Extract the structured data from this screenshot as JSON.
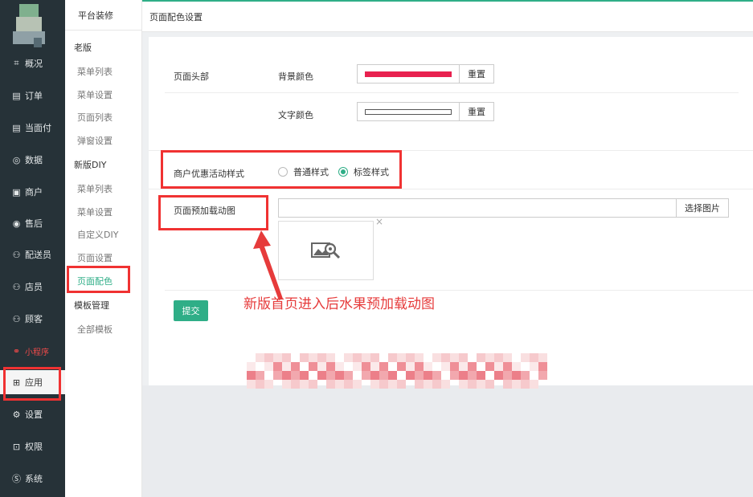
{
  "sidebar": {
    "items": [
      {
        "label": "概况",
        "icon": "overview-icon",
        "glyph": "⌗"
      },
      {
        "label": "订单",
        "icon": "order-icon",
        "glyph": "▤"
      },
      {
        "label": "当面付",
        "icon": "pay-icon",
        "glyph": "▤"
      },
      {
        "label": "数据",
        "icon": "data-icon",
        "glyph": "◎"
      },
      {
        "label": "商户",
        "icon": "merchant-icon",
        "glyph": "▣"
      },
      {
        "label": "售后",
        "icon": "aftersale-icon",
        "glyph": "◉"
      },
      {
        "label": "配送员",
        "icon": "courier-icon",
        "glyph": "⚇"
      },
      {
        "label": "店员",
        "icon": "clerk-icon",
        "glyph": "⚇"
      },
      {
        "label": "顾客",
        "icon": "customer-icon",
        "glyph": "⚇"
      },
      {
        "label": "小程序",
        "icon": "miniapp-icon",
        "glyph": "⚭"
      },
      {
        "label": "应用",
        "icon": "app-icon",
        "glyph": "⊞"
      },
      {
        "label": "设置",
        "icon": "settings-icon",
        "glyph": "⚙"
      },
      {
        "label": "权限",
        "icon": "lock-icon",
        "glyph": "⊡"
      },
      {
        "label": "系统",
        "icon": "system-icon",
        "glyph": "Ⓢ"
      }
    ]
  },
  "submenu": {
    "title": "平台装修",
    "groups": [
      {
        "label": "老版",
        "items": [
          "菜单列表",
          "菜单设置",
          "页面列表",
          "弹窗设置"
        ]
      },
      {
        "label": "新版DIY",
        "items": [
          "菜单列表",
          "菜单设置",
          "自定义DIY",
          "页面设置",
          "页面配色"
        ]
      },
      {
        "label": "模板管理",
        "items": [
          "全部模板"
        ]
      }
    ]
  },
  "page": {
    "title": "页面配色设置",
    "header_section_label": "页面头部",
    "bg_color_label": "背景颜色",
    "bg_color_value": "#e8214f",
    "text_color_label": "文字颜色",
    "text_color_value": "#ffffff",
    "reset_label": "重置",
    "promo_style_label": "商户优惠活动样式",
    "promo_options": [
      {
        "label": "普通样式",
        "checked": false
      },
      {
        "label": "标签样式",
        "checked": true
      }
    ],
    "preload_label": "页面预加载动图",
    "preload_value": "",
    "pick_image_label": "选择图片",
    "thumb_close": "×",
    "submit_label": "提交"
  },
  "annotation": {
    "note": "新版首页进入后水果预加载动图"
  },
  "colors": {
    "accent": "#2fae87",
    "sidebar_bg": "#263238",
    "highlight_red": "#f03232"
  }
}
